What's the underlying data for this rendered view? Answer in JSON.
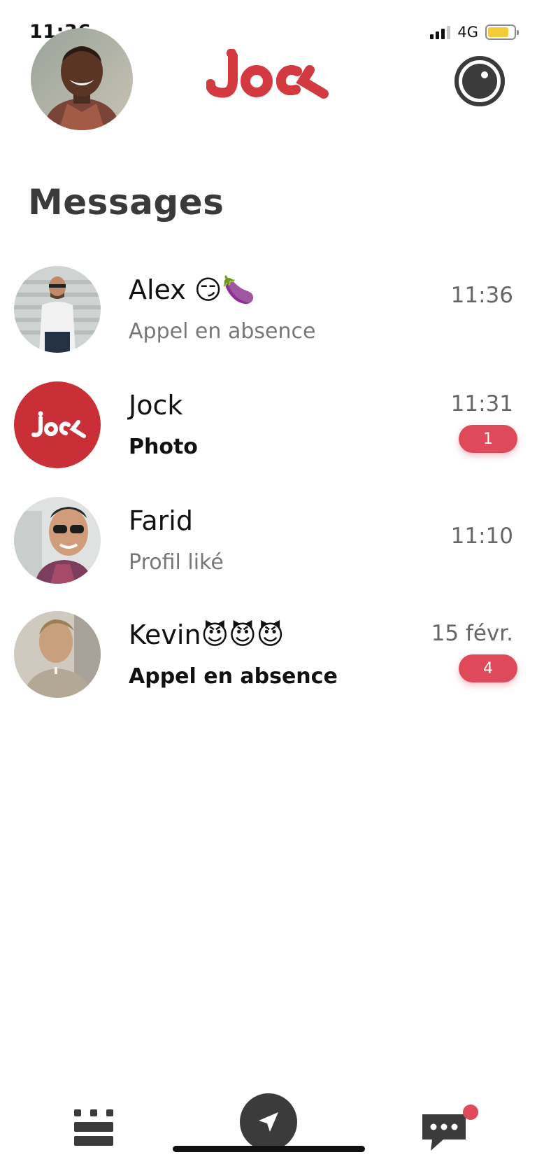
{
  "status_bar": {
    "time": "11:36",
    "network": "4G",
    "battery_level": 0.8,
    "battery_color": "#f4cc3a"
  },
  "header": {
    "logo_text": "jock",
    "brand_color": "#d33a3f"
  },
  "page": {
    "title": "Messages"
  },
  "conversations": [
    {
      "name": "Alex 😏🍆",
      "preview": "Appel en absence",
      "time": "11:36",
      "unread": false,
      "badge": ""
    },
    {
      "name": "Jock",
      "preview": "Photo",
      "time": "11:31",
      "unread": true,
      "badge": "1"
    },
    {
      "name": "Farid",
      "preview": "Profil liké",
      "time": "11:10",
      "unread": false,
      "badge": ""
    },
    {
      "name": "Kevin😈😈😈",
      "preview": "Appel en absence",
      "time": "15 févr.",
      "unread": true,
      "badge": "4"
    }
  ],
  "bottom_nav": {
    "items": [
      {
        "icon": "grid-list-icon"
      },
      {
        "icon": "location-arrow-icon"
      },
      {
        "icon": "chat-bubble-icon",
        "has_notification": true
      }
    ]
  },
  "colors": {
    "badge": "#de4a5a",
    "icon_dark": "#3b3b3b"
  }
}
